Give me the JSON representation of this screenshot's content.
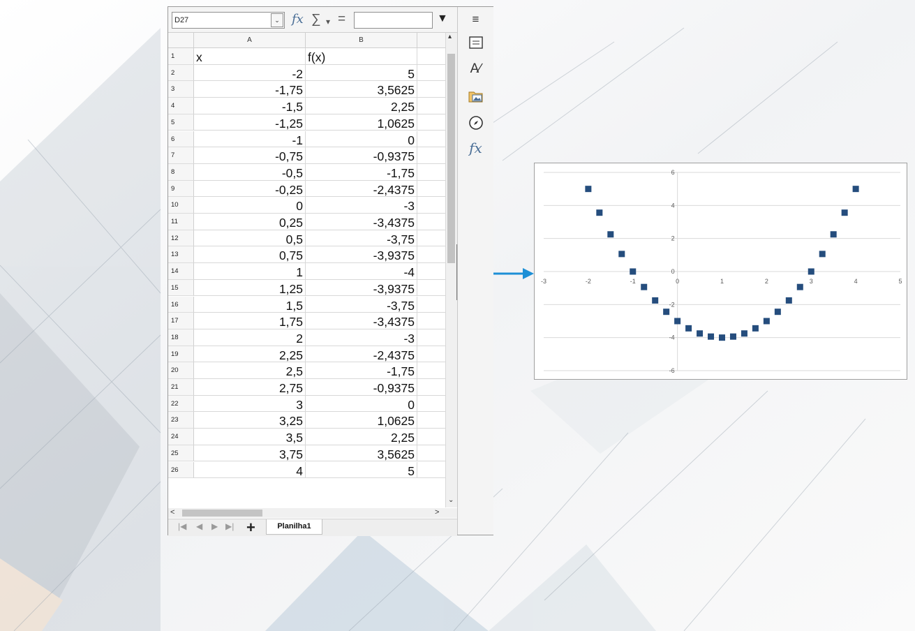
{
  "spreadsheet": {
    "name_box": "D27",
    "formula_value": "",
    "columns": [
      "A",
      "B"
    ],
    "rows": [
      {
        "num": "1",
        "a": "x",
        "b": "f(x)"
      },
      {
        "num": "2",
        "a": "-2",
        "b": "5"
      },
      {
        "num": "3",
        "a": "-1,75",
        "b": "3,5625"
      },
      {
        "num": "4",
        "a": "-1,5",
        "b": "2,25"
      },
      {
        "num": "5",
        "a": "-1,25",
        "b": "1,0625"
      },
      {
        "num": "6",
        "a": "-1",
        "b": "0"
      },
      {
        "num": "7",
        "a": "-0,75",
        "b": "-0,9375"
      },
      {
        "num": "8",
        "a": "-0,5",
        "b": "-1,75"
      },
      {
        "num": "9",
        "a": "-0,25",
        "b": "-2,4375"
      },
      {
        "num": "10",
        "a": "0",
        "b": "-3"
      },
      {
        "num": "11",
        "a": "0,25",
        "b": "-3,4375"
      },
      {
        "num": "12",
        "a": "0,5",
        "b": "-3,75"
      },
      {
        "num": "13",
        "a": "0,75",
        "b": "-3,9375"
      },
      {
        "num": "14",
        "a": "1",
        "b": "-4"
      },
      {
        "num": "15",
        "a": "1,25",
        "b": "-3,9375"
      },
      {
        "num": "16",
        "a": "1,5",
        "b": "-3,75"
      },
      {
        "num": "17",
        "a": "1,75",
        "b": "-3,4375"
      },
      {
        "num": "18",
        "a": "2",
        "b": "-3"
      },
      {
        "num": "19",
        "a": "2,25",
        "b": "-2,4375"
      },
      {
        "num": "20",
        "a": "2,5",
        "b": "-1,75"
      },
      {
        "num": "21",
        "a": "2,75",
        "b": "-0,9375"
      },
      {
        "num": "22",
        "a": "3",
        "b": "0"
      },
      {
        "num": "23",
        "a": "3,25",
        "b": "1,0625"
      },
      {
        "num": "24",
        "a": "3,5",
        "b": "2,25"
      },
      {
        "num": "25",
        "a": "3,75",
        "b": "3,5625"
      },
      {
        "num": "26",
        "a": "4",
        "b": "5"
      }
    ],
    "sheet_tab": "Planilha1",
    "icons": {
      "function_wizard": "fx-icon",
      "sum": "sum-icon",
      "equals": "equals-icon",
      "sidebar": [
        "menu-icon",
        "properties-icon",
        "styles-icon",
        "gallery-icon",
        "navigator-icon",
        "functions-icon"
      ]
    }
  },
  "colors": {
    "marker": "#254d7d",
    "arrow": "#1d8fd6",
    "grid": "#d9d9d9",
    "axis_text": "#595959"
  },
  "chart_data": {
    "type": "scatter",
    "marker": "square",
    "x": [
      -2,
      -1.75,
      -1.5,
      -1.25,
      -1,
      -0.75,
      -0.5,
      -0.25,
      0,
      0.25,
      0.5,
      0.75,
      1,
      1.25,
      1.5,
      1.75,
      2,
      2.25,
      2.5,
      2.75,
      3,
      3.25,
      3.5,
      3.75,
      4
    ],
    "y": [
      5,
      3.5625,
      2.25,
      1.0625,
      0,
      -0.9375,
      -1.75,
      -2.4375,
      -3,
      -3.4375,
      -3.75,
      -3.9375,
      -4,
      -3.9375,
      -3.75,
      -3.4375,
      -3,
      -2.4375,
      -1.75,
      -0.9375,
      0,
      1.0625,
      2.25,
      3.5625,
      5
    ],
    "xlim": [
      -3,
      5
    ],
    "ylim": [
      -6,
      6
    ],
    "x_ticks": [
      -3,
      -2,
      -1,
      0,
      1,
      2,
      3,
      4,
      5
    ],
    "y_ticks": [
      -6,
      -4,
      -2,
      0,
      2,
      4,
      6
    ],
    "x_tick_labels": [
      "-3",
      "-2",
      "-1",
      "0",
      "1",
      "2",
      "3",
      "4",
      "5"
    ],
    "y_tick_labels": [
      "-6",
      "-4",
      "-2",
      "0",
      "2",
      "4",
      "6"
    ],
    "grid": true,
    "title": "",
    "xlabel": "",
    "ylabel": ""
  }
}
